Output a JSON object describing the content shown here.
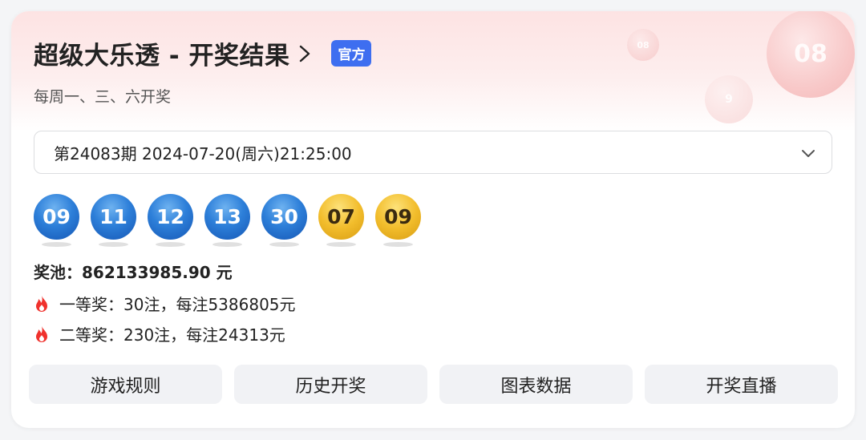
{
  "header": {
    "title": "超级大乐透 - 开奖结果",
    "badge": "官方",
    "subtitle": "每周一、三、六开奖",
    "decor_numbers": [
      "08",
      "08",
      "9"
    ]
  },
  "period_select": {
    "value": "第24083期 2024-07-20(周六)21:25:00"
  },
  "draw": {
    "front_numbers": [
      "09",
      "11",
      "12",
      "13",
      "30"
    ],
    "back_numbers": [
      "07",
      "09"
    ],
    "front_color": "#2d7fd9",
    "back_color": "#f2bd2c"
  },
  "pool": "奖池：862133985.90 元",
  "prizes": [
    {
      "text": "一等奖：30注，每注5386805元",
      "icon": "flame-icon"
    },
    {
      "text": "二等奖：230注，每注24313元",
      "icon": "flame-icon"
    }
  ],
  "actions": [
    {
      "label": "游戏规则"
    },
    {
      "label": "历史开奖"
    },
    {
      "label": "图表数据"
    },
    {
      "label": "开奖直播"
    }
  ],
  "colors": {
    "accent": "#3e6ef0",
    "flame": "#f0322d"
  }
}
